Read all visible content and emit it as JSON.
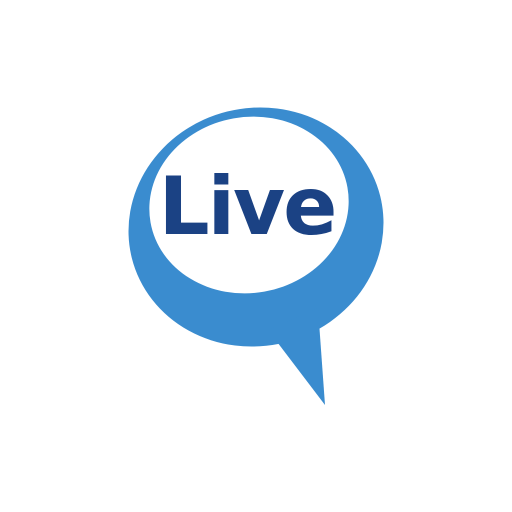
{
  "logo": {
    "text": "Live",
    "bubble_color": "#3a8ccf",
    "inner_color": "#ffffff",
    "text_color": "#1b4284"
  }
}
